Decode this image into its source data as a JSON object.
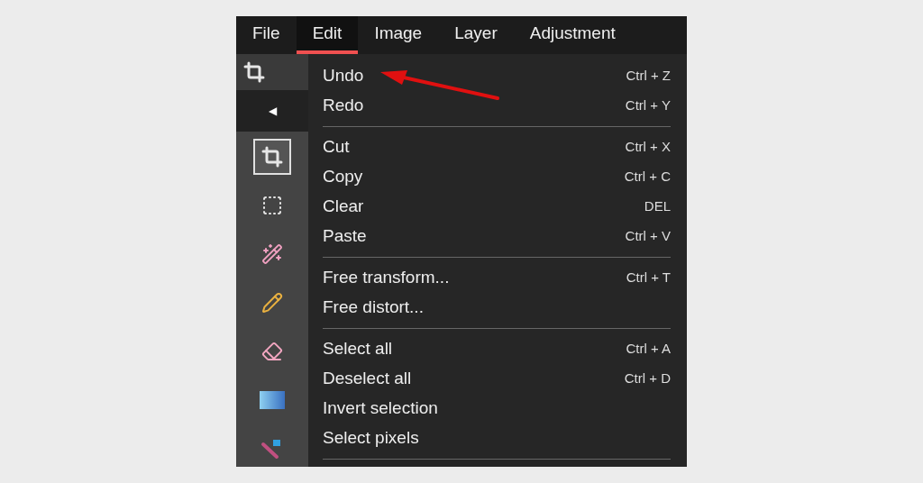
{
  "menubar": [
    {
      "label": "File",
      "selected": false
    },
    {
      "label": "Edit",
      "selected": true
    },
    {
      "label": "Image",
      "selected": false
    },
    {
      "label": "Layer",
      "selected": false
    },
    {
      "label": "Adjustment",
      "selected": false
    }
  ],
  "collapse_arrow": "◀",
  "tools": [
    {
      "kind": "crop",
      "selected": true
    },
    {
      "kind": "marquee",
      "selected": false
    },
    {
      "kind": "wand",
      "selected": false
    },
    {
      "kind": "pencil",
      "selected": false
    },
    {
      "kind": "eraser",
      "selected": false
    },
    {
      "kind": "gradient",
      "selected": false
    },
    {
      "kind": "replace",
      "selected": false
    }
  ],
  "edit_menu": [
    [
      {
        "label": "Undo",
        "shortcut": "Ctrl + Z"
      },
      {
        "label": "Redo",
        "shortcut": "Ctrl + Y"
      }
    ],
    [
      {
        "label": "Cut",
        "shortcut": "Ctrl + X"
      },
      {
        "label": "Copy",
        "shortcut": "Ctrl + C"
      },
      {
        "label": "Clear",
        "shortcut": "DEL"
      },
      {
        "label": "Paste",
        "shortcut": "Ctrl + V"
      }
    ],
    [
      {
        "label": "Free transform...",
        "shortcut": "Ctrl + T"
      },
      {
        "label": "Free distort..."
      }
    ],
    [
      {
        "label": "Select all",
        "shortcut": "Ctrl + A"
      },
      {
        "label": "Deselect all",
        "shortcut": "Ctrl + D"
      },
      {
        "label": "Invert selection"
      },
      {
        "label": "Select pixels"
      }
    ]
  ]
}
